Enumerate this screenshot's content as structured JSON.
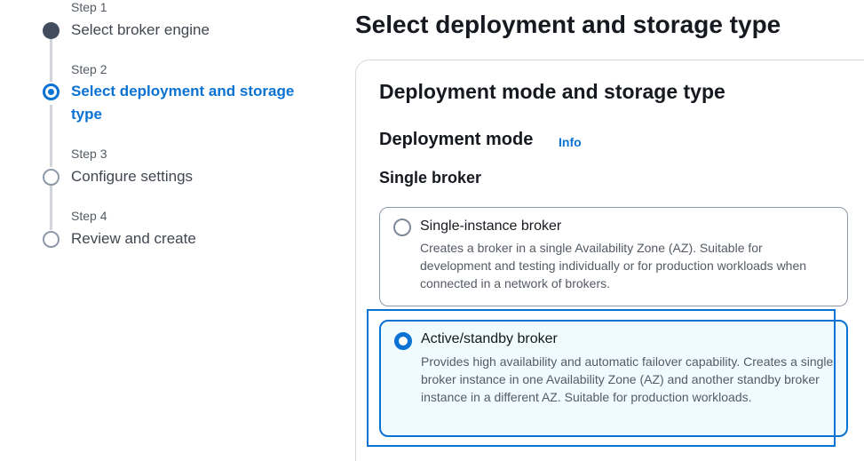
{
  "wizard": {
    "steps": [
      {
        "number": "Step 1",
        "title": "Select broker engine",
        "state": "complete"
      },
      {
        "number": "Step 2",
        "title_line1": "Select deployment and storage",
        "title_line2": "type",
        "state": "current"
      },
      {
        "number": "Step 3",
        "title": "Configure settings",
        "state": "pending"
      },
      {
        "number": "Step 4",
        "title": "Review and create",
        "state": "pending"
      }
    ]
  },
  "main": {
    "page_title": "Select deployment and storage type",
    "container_title": "Deployment mode and storage type",
    "section_title": "Deployment mode",
    "info_link": "Info",
    "group_label": "Single broker",
    "options": [
      {
        "label": "Single-instance broker",
        "description": "Creates a broker in a single Availability Zone (AZ). Suitable for development and testing individually or for production workloads when connected in a network of brokers.",
        "selected": false
      },
      {
        "label": "Active/standby broker",
        "description": "Provides high availability and automatic failover capability. Creates a single broker instance in one Availability Zone (AZ) and another standby broker instance in a different AZ. Suitable for production workloads.",
        "selected": true
      }
    ]
  },
  "colors": {
    "accent": "#0972d3",
    "selected_background": "#f0fbff",
    "text": "#16191f",
    "muted_text": "#545b64"
  }
}
